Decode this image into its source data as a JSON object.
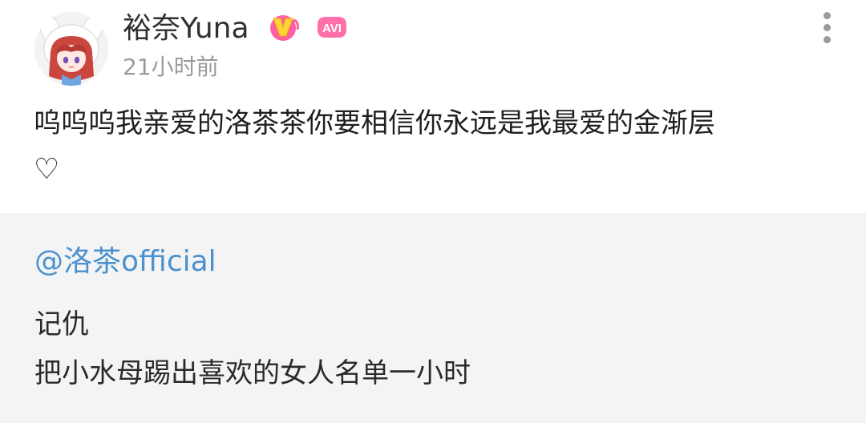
{
  "post": {
    "author": {
      "name": "裕奈Yuna",
      "badges": [
        {
          "icon": "vip-v-badge-icon",
          "color": "#ffcc33"
        },
        {
          "icon": "avi-badge-icon",
          "label": "AVI",
          "color": "#ff6fa8"
        }
      ]
    },
    "timestamp": "21小时前",
    "text_line_1": "呜呜呜我亲爱的洛茶茶你要相信你永远是我最爱的金渐层",
    "text_line_2": "♡",
    "menu_icon": "more-vertical-icon"
  },
  "repost": {
    "mention": "@洛茶official",
    "line_1": "记仇",
    "line_2": "把小水母踢出喜欢的女人名单一小时"
  },
  "colors": {
    "mention_blue": "#4a91cf",
    "timestamp_gray": "#9b9b9b",
    "repost_background": "#f4f4f4"
  }
}
